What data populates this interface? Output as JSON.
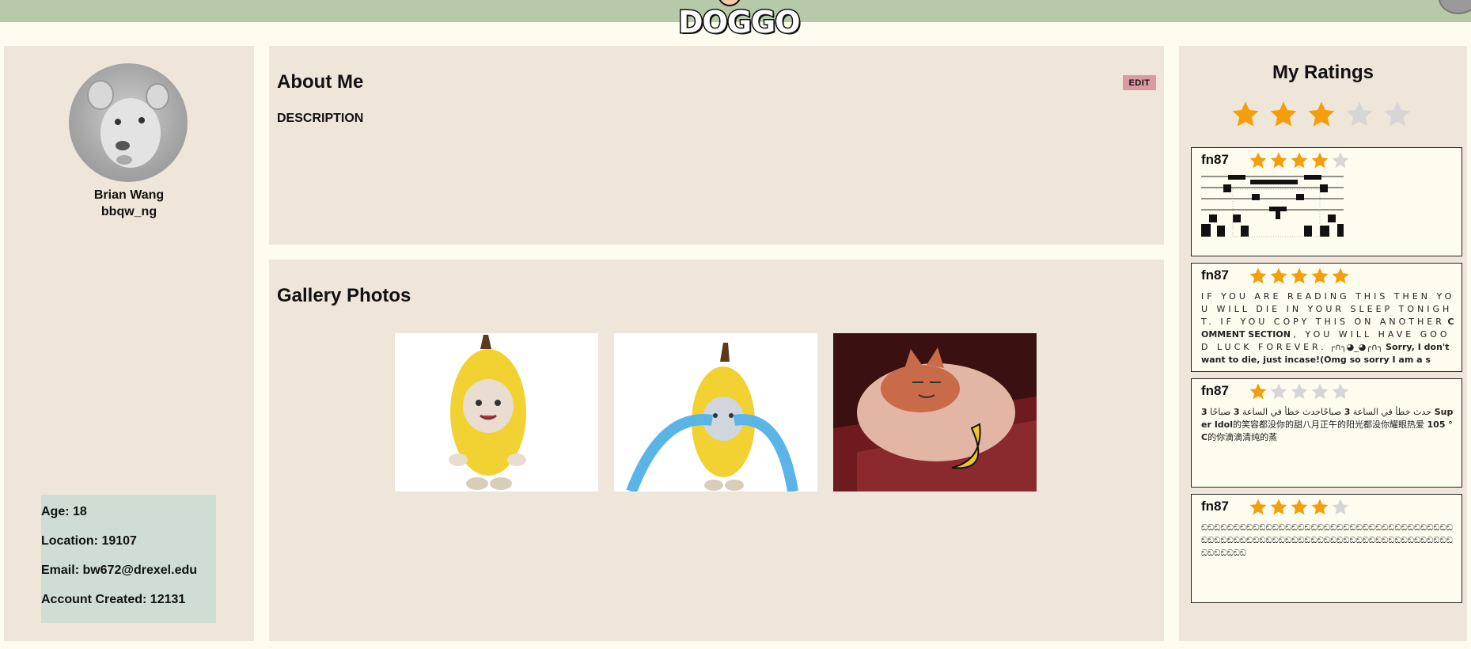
{
  "header": {
    "logo_text": "DOGGO"
  },
  "profile": {
    "name": "Brian Wang",
    "username": "bbqw_ng",
    "age_text": "Age: 18",
    "location_text": "Location: 19107",
    "email_text": "Email: bw672@drexel.edu",
    "created_text": "Account Created: 12131"
  },
  "about": {
    "title": "About Me",
    "edit_label": "EDIT",
    "description_label": "DESCRIPTION"
  },
  "gallery": {
    "title": "Gallery Photos"
  },
  "ratings": {
    "title": "My Ratings",
    "overall_stars": 3,
    "max_stars": 5,
    "star_color": "#f59e0b",
    "empty_star_color": "#d6d6d6",
    "reviews": [
      {
        "user": "fn87",
        "stars": 4,
        "text": ""
      },
      {
        "user": "fn87",
        "stars": 5,
        "text_spaced": "IF YOU ARE READING THIS THEN YOU WILL DIE IN YOUR SLEEP TONIGHT. IF YOU COPY THIS ON ANOTHER",
        "text_bold_1": "COMMENT SECTION",
        "text_spaced_2": ", YOU WILL HAVE GOOD LUCK FOREVER.",
        "text_emoji": "╭∩╮◕_◕╭∩╮",
        "text_bold_2": "Sorry, I don't want to die, just incase!(Omg so sorry I am a s"
      },
      {
        "user": "fn87",
        "stars": 1,
        "text_a": "حدث خطأ في الساعة",
        "text_b": "3",
        "text_c": "صباحًاحدث خطأ في الساعة",
        "text_d": "3",
        "text_e": "صباحًا",
        "text_f": "3 Super Idol",
        "text_g": "的笑容都没你的甜八月正午的阳光都没你耀眼热爱",
        "text_h": "105 °C",
        "text_i": "的你滴滴清纯的蒸"
      },
      {
        "user": "fn87",
        "stars": 4,
        "text": "ඞඞඞඞඞඞඞඞඞඞඞඞඞඞඞඞඞඞඞඞඞඞඞඞඞඞඞඞඞඞඞඞඞඞඞඞඞඞඞඞඞඞඞඞඞඞඞඞඞඞඞඞඞඞඞඞඞඞඞඞඞඞඞඞඞඞඞඞඞඞඞඞඞඞඞඞඞඞඞඞඞඞඞඞඞ"
      }
    ]
  }
}
